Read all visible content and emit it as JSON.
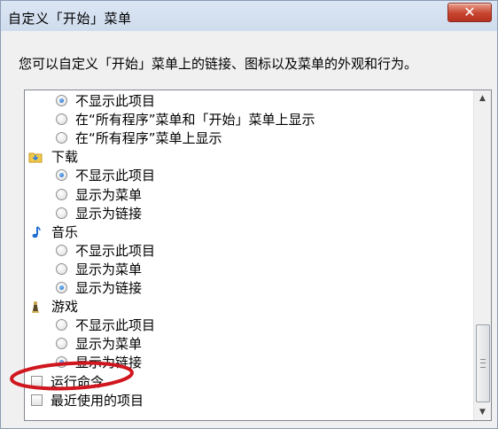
{
  "window": {
    "title": "自定义「开始」菜单",
    "close_icon": "close-icon",
    "close_color": "#c7442f"
  },
  "description": "您可以自定义「开始」菜单上的链接、图标以及菜单的外观和行为。",
  "list": {
    "rows": [
      {
        "kind": "radio",
        "checked": true,
        "label": "不显示此项目"
      },
      {
        "kind": "radio",
        "checked": false,
        "label": "在“所有程序”菜单和「开始」菜单上显示"
      },
      {
        "kind": "radio",
        "checked": false,
        "label": "在“所有程序”菜单上显示"
      },
      {
        "kind": "group",
        "icon": "downloads-folder-icon",
        "label": "下载"
      },
      {
        "kind": "radio",
        "checked": true,
        "label": "不显示此项目"
      },
      {
        "kind": "radio",
        "checked": false,
        "label": "显示为菜单"
      },
      {
        "kind": "radio",
        "checked": false,
        "label": "显示为链接"
      },
      {
        "kind": "group",
        "icon": "music-note-icon",
        "label": "音乐"
      },
      {
        "kind": "radio",
        "checked": false,
        "label": "不显示此项目"
      },
      {
        "kind": "radio",
        "checked": false,
        "label": "显示为菜单"
      },
      {
        "kind": "radio",
        "checked": true,
        "label": "显示为链接"
      },
      {
        "kind": "group",
        "icon": "games-icon",
        "label": "游戏"
      },
      {
        "kind": "radio",
        "checked": false,
        "label": "不显示此项目"
      },
      {
        "kind": "radio",
        "checked": false,
        "label": "显示为菜单"
      },
      {
        "kind": "radio",
        "checked": true,
        "label": "显示为链接"
      },
      {
        "kind": "checkbox",
        "checked": false,
        "label": "运行命令"
      },
      {
        "kind": "checkbox",
        "checked": false,
        "label": "最近使用的项目"
      }
    ]
  },
  "scrollbar": {
    "up_icon": "scroll-up-arrow-icon",
    "down_icon": "scroll-down-arrow-icon",
    "grip_icon": "scroll-grip-icon"
  },
  "annotation": {
    "shape": "red-ellipse",
    "color": "#d0161e",
    "target": "运行命令"
  }
}
